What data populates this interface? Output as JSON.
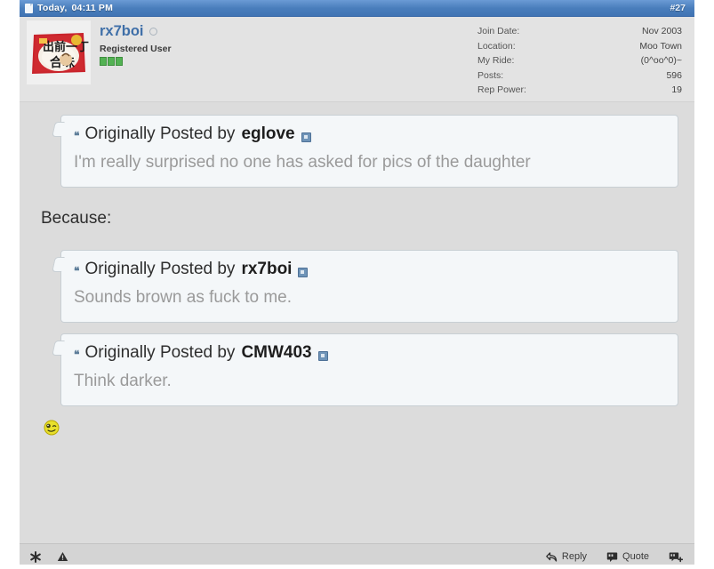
{
  "header": {
    "doc_icon": "document-icon",
    "date_label": "Today,",
    "time_label": "04:11 PM",
    "post_number": "#27",
    "bar_color": "#4a7ebc"
  },
  "user": {
    "name": "rx7boi",
    "status_icon": "offline-circle-icon",
    "title": "Registered User",
    "reputation_blocks": 3,
    "reputation_color": "#53b253",
    "avatar_alt": "instant-noodle-package-avatar",
    "stats": [
      {
        "label": "Join Date:",
        "value": "Nov 2003"
      },
      {
        "label": "Location:",
        "value": "Moo Town"
      },
      {
        "label": "My Ride:",
        "value": "(0^oo^0)~"
      },
      {
        "label": "Posts:",
        "value": "596"
      },
      {
        "label": "Rep Power:",
        "value": "19"
      }
    ]
  },
  "body": {
    "quote_prefix": "Originally Posted by",
    "quote_marks": "❝",
    "quotes": [
      {
        "author": "eglove",
        "text": "I'm really surprised no one has asked for pics of the daughter"
      },
      {
        "author": "rx7boi",
        "text": "Sounds brown as fuck to me."
      },
      {
        "author": "CMW403",
        "text": "Think darker."
      }
    ],
    "plain_text": "Because:",
    "emoticon": "wink-smiley-emoticon"
  },
  "footer": {
    "left_icons": [
      {
        "name": "asterisk-icon"
      },
      {
        "name": "warning-triangle-icon"
      }
    ],
    "actions": [
      {
        "name": "reply-button",
        "label": "Reply",
        "icon": "reply-arrow-icon"
      },
      {
        "name": "quote-button",
        "label": "Quote",
        "icon": "quote-bubble-icon"
      },
      {
        "name": "multiquote-button",
        "label": "",
        "icon": "multiquote-bubble-plus-icon"
      }
    ]
  }
}
